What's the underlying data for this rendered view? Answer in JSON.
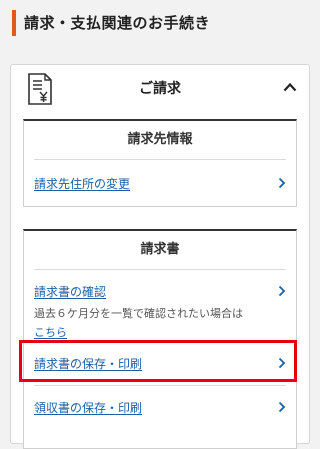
{
  "page": {
    "title": "請求・支払関連のお手続き"
  },
  "accordion": {
    "title": "ご請求",
    "expanded": true,
    "icon": "invoice-yen-icon",
    "colors": {
      "title_bar": "#e05a1e",
      "link": "#1b5fa8",
      "highlight": "#e60012"
    },
    "sections": [
      {
        "title": "請求先情報",
        "items": [
          {
            "label": "請求先住所の変更"
          }
        ]
      },
      {
        "title": "請求書",
        "items": [
          {
            "label": "請求書の確認",
            "note": "過去６ケ月分を一覧で確認されたい場合は",
            "note_link": "こちら"
          },
          {
            "label": "請求書の保存・印刷",
            "highlighted": true
          },
          {
            "label": "領収書の保存・印刷"
          }
        ]
      }
    ]
  }
}
